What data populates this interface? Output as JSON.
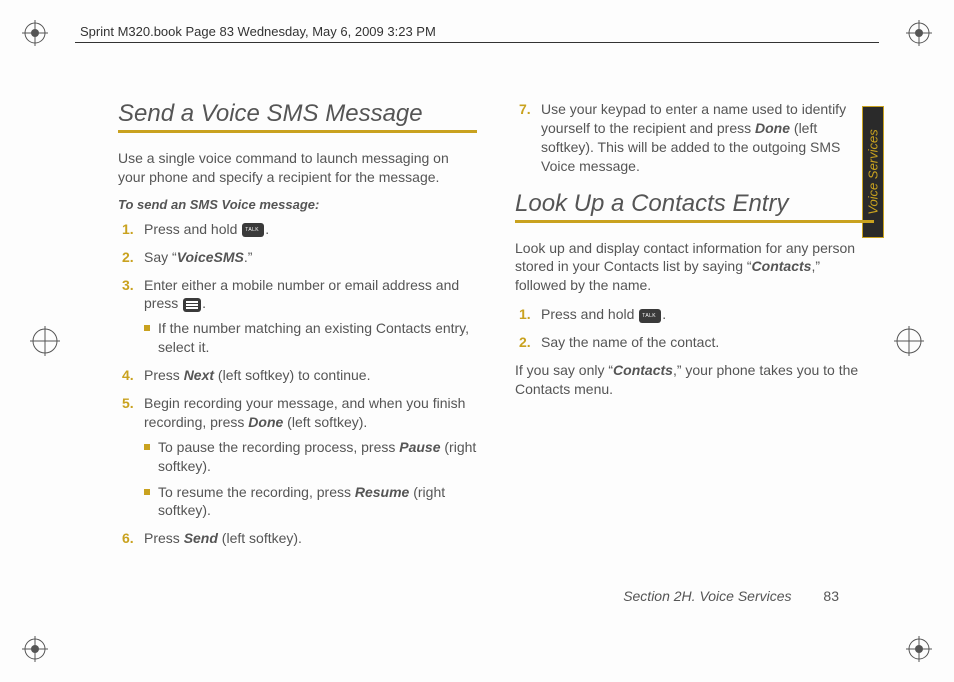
{
  "header": "Sprint M320.book  Page 83  Wednesday, May 6, 2009  3:23 PM",
  "side_tab": "Voice Services",
  "footer": {
    "section": "Section 2H. Voice Services",
    "page": "83"
  },
  "left": {
    "title": "Send a Voice SMS Message",
    "intro": "Use a single voice command to launch messaging on your phone and specify a recipient for the message.",
    "subhead": "To send an SMS Voice message:",
    "steps": {
      "s1a": "Press and hold ",
      "s1b": ".",
      "s2a": "Say “",
      "s2em": "VoiceSMS",
      "s2b": ".”",
      "s3a": "Enter either a mobile number or email address and press ",
      "s3b": ".",
      "s3_sub1": "If the number matching an existing Contacts entry, select it.",
      "s4a": "Press ",
      "s4em": "Next",
      "s4b": " (left softkey) to continue.",
      "s5a": "Begin recording your message, and when you finish recording, press ",
      "s5em": "Done",
      "s5b": " (left softkey).",
      "s5_sub1a": "To pause the recording process, press ",
      "s5_sub1em": "Pause",
      "s5_sub1b": " (right softkey).",
      "s5_sub2a": "To resume the recording, press ",
      "s5_sub2em": "Resume",
      "s5_sub2b": " (right softkey).",
      "s6a": "Press ",
      "s6em": "Send",
      "s6b": " (left softkey)."
    }
  },
  "right": {
    "step7a": "Use your keypad to enter a name used to identify yourself to the recipient and press ",
    "step7em": "Done",
    "step7b": " (left softkey). This will be added to the outgoing SMS Voice message.",
    "title": "Look Up a Contacts Entry",
    "intro_a": "Look up and display contact information for any person stored in your Contacts list by saying “",
    "intro_em": "Contacts",
    "intro_b": ",” followed by the name.",
    "s1a": "Press and hold ",
    "s1b": ".",
    "s2": "Say the name of the contact.",
    "outro_a": "If you say only “",
    "outro_em": "Contacts",
    "outro_b": ",” your phone takes you to the Contacts menu."
  }
}
